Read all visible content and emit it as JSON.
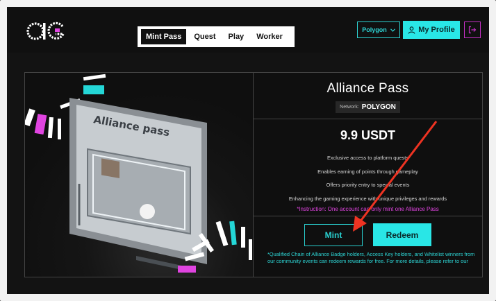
{
  "header": {
    "logo_text": "aG",
    "nav": [
      {
        "label": "Mint Pass",
        "active": true
      },
      {
        "label": "Quest",
        "active": false
      },
      {
        "label": "Play",
        "active": false
      },
      {
        "label": "Worker",
        "active": false
      }
    ],
    "chain_label": "Polygon",
    "profile_label": "My Profile"
  },
  "pass": {
    "art_text": "Alliance pass",
    "title": "Alliance Pass",
    "network_label": "Network:",
    "network_value": "POLYGON",
    "price": "9.9 USDT",
    "benefits": [
      "Exclusive access to platform quests",
      "Enables earning of points through gameplay",
      "Offers priority entry to special events",
      "Enhancing the gaming experience with unique privileges and rewards"
    ],
    "instruction": "*Instruction: One account can only mint one Alliance Pass",
    "mint_label": "Mint",
    "redeem_label": "Redeem",
    "note": "*Qualified Chain of Alliance Badge holders, Access Key holders, and Whitelist winners from our community events can redeem rewards for free. For more details, please",
    "note_link": "refer to our"
  },
  "colors": {
    "accent_cyan": "#29e6e6",
    "accent_magenta": "#e044e0",
    "annotation_arrow": "#ee3322"
  },
  "icons": {
    "chain_caret": "chevron-down-icon",
    "profile": "user-icon",
    "logout": "logout-icon"
  }
}
